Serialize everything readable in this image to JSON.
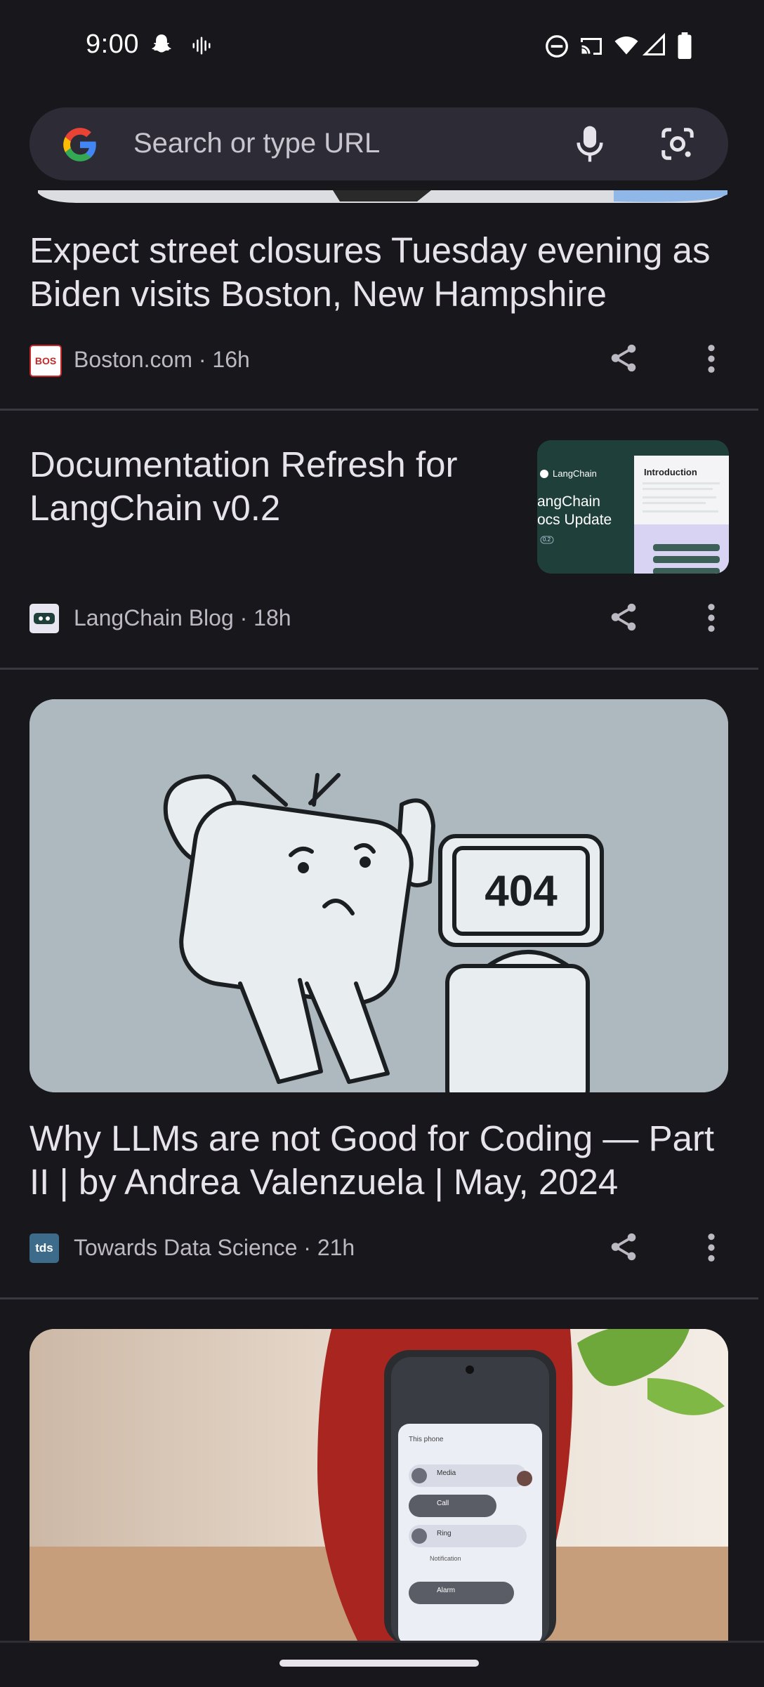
{
  "status_bar": {
    "time": "9:00",
    "left_icons": [
      "snapchat-icon",
      "voice-waveform-icon"
    ],
    "right_icons": [
      "do-not-disturb-icon",
      "cast-icon",
      "wifi-icon",
      "cellular-signal-icon",
      "battery-icon"
    ]
  },
  "search": {
    "placeholder": "Search or type URL",
    "left_icon": "google-g-icon",
    "right_icons": [
      "microphone-icon",
      "google-lens-icon"
    ]
  },
  "feed": {
    "items": [
      {
        "headline": "Expect street closures Tuesday evening as Biden visits Boston, New Hampshire",
        "source": "Boston.com · 16h",
        "favicon_text": "BOS"
      },
      {
        "headline": "Documentation Refresh for LangChain v0.2",
        "source": "LangChain Blog · 18h",
        "thumbnail": {
          "brand": "LangChain",
          "title_line1": "angChain",
          "title_line2": "ocs Update",
          "version": "0.2",
          "panel_title": "Introduction"
        }
      },
      {
        "headline": "Why LLMs are not Good for Coding — Part II | by Andrea Valenzuela | May, 2024",
        "source": "Towards Data Science · 21h",
        "favicon_text": "tds",
        "image_text": "404"
      },
      {
        "image_texts": [
          "Media",
          "Call",
          "Ring",
          "Notification",
          "Alarm"
        ],
        "phone_panel_title": "This phone"
      }
    ]
  },
  "colors": {
    "background": "#18171c",
    "searchbar": "#2d2c36",
    "text": "#e6e3ea",
    "muted": "#bdb9c3"
  }
}
